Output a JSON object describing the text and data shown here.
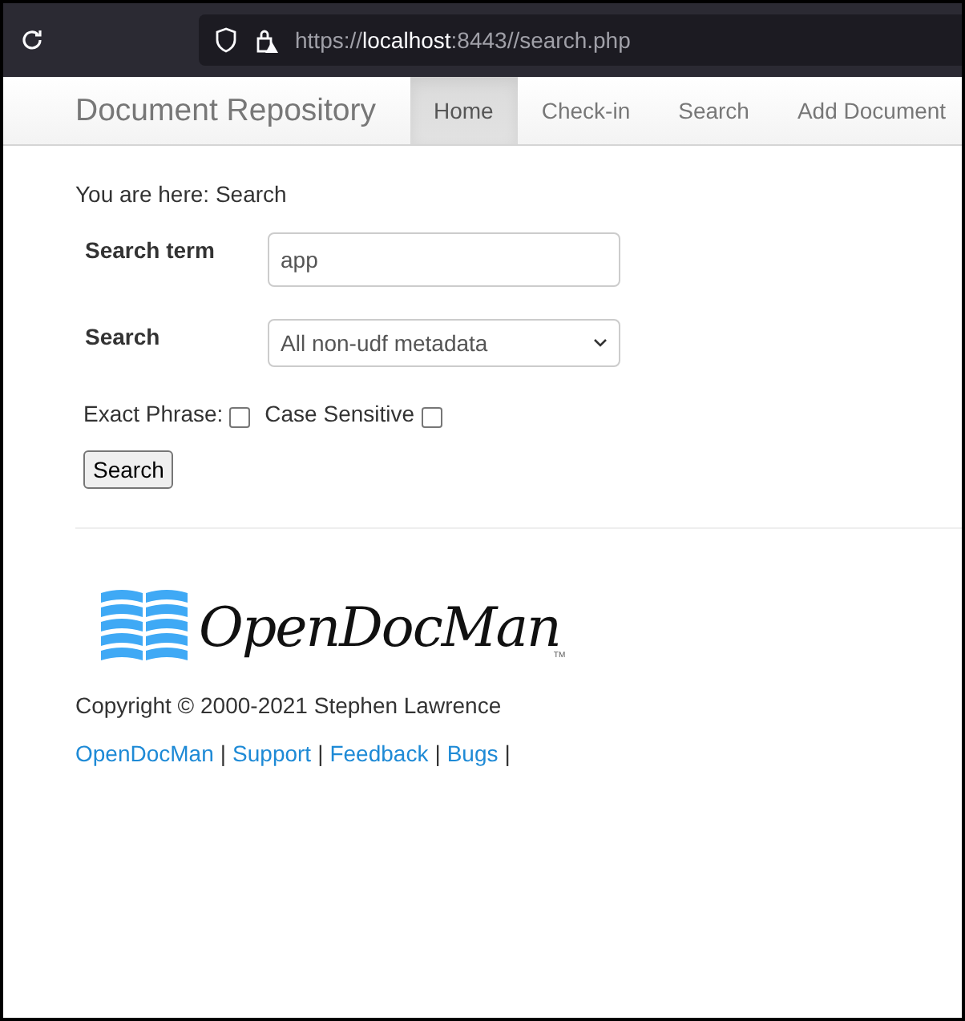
{
  "browser": {
    "url_host_prefix": "https://",
    "url_host": "localhost",
    "url_rest": ":8443//search.php"
  },
  "navbar": {
    "brand": "Document Repository",
    "tabs": [
      {
        "label": "Home",
        "selected": true
      },
      {
        "label": "Check-in",
        "selected": false
      },
      {
        "label": "Search",
        "selected": false
      },
      {
        "label": "Add Document",
        "selected": false
      }
    ]
  },
  "breadcrumb": "You are here: Search",
  "form": {
    "fields": [
      {
        "kind": "text",
        "label": "Search term",
        "value": "app"
      },
      {
        "kind": "select",
        "label": "Search",
        "value": "All non-udf metadata"
      }
    ],
    "options": [
      {
        "label": "Exact Phrase:",
        "checked": false
      },
      {
        "label": "Case Sensitive",
        "checked": false
      }
    ],
    "submit": "Search"
  },
  "footer": {
    "logo": {
      "name": "OpenDocMan",
      "tm": "TM"
    },
    "copyright": "Copyright © 2000-2021 Stephen Lawrence",
    "links": [
      {
        "kind": "link",
        "text": "OpenDocMan"
      },
      {
        "kind": "sep",
        "text": "|"
      },
      {
        "kind": "link",
        "text": "Support"
      },
      {
        "kind": "sep",
        "text": "|"
      },
      {
        "kind": "link",
        "text": "Feedback"
      },
      {
        "kind": "sep",
        "text": "|"
      },
      {
        "kind": "link",
        "text": "Bugs"
      },
      {
        "kind": "sep",
        "text": "|"
      }
    ]
  }
}
